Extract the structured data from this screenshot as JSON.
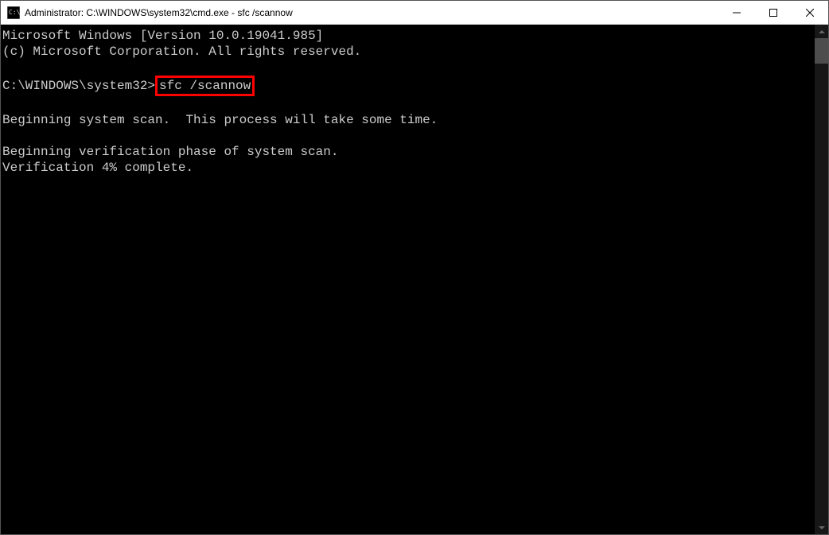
{
  "window": {
    "title": "Administrator: C:\\WINDOWS\\system32\\cmd.exe - sfc  /scannow"
  },
  "terminal": {
    "line1": "Microsoft Windows [Version 10.0.19041.985]",
    "line2": "(c) Microsoft Corporation. All rights reserved.",
    "prompt": "C:\\WINDOWS\\system32>",
    "command": "sfc /scannow",
    "line4": "Beginning system scan.  This process will take some time.",
    "line5": "Beginning verification phase of system scan.",
    "line6": "Verification 4% complete."
  }
}
